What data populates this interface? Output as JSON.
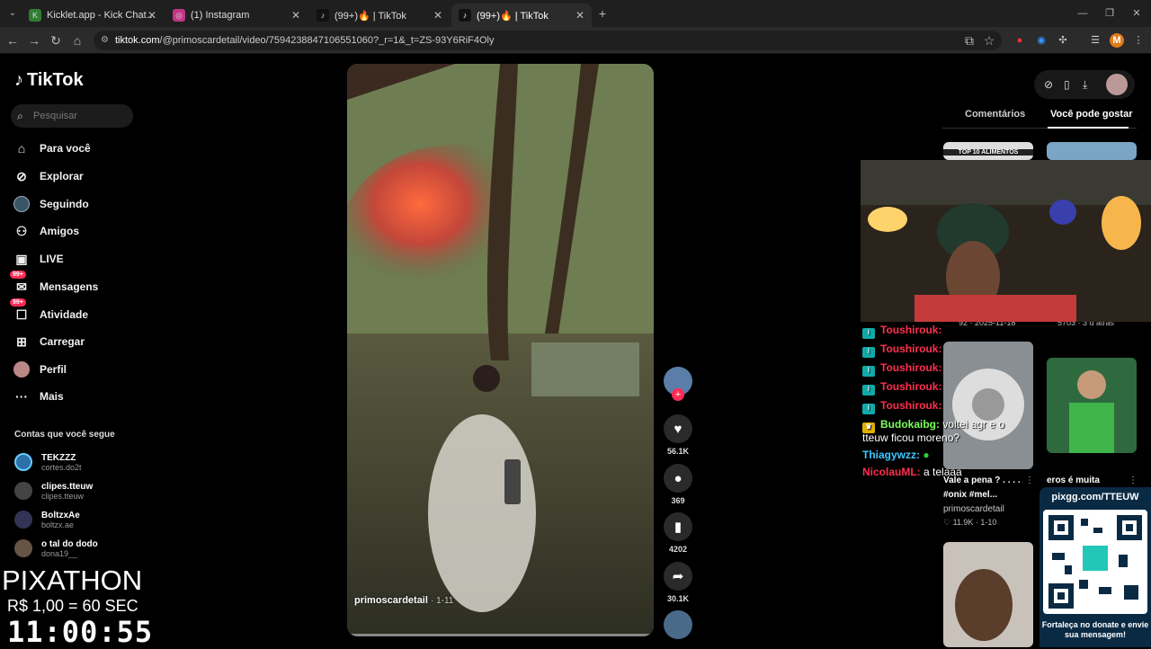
{
  "browser": {
    "tabs": [
      {
        "title": "Kicklet.app - Kick Chatbot and",
        "active": false
      },
      {
        "title": "(1) Instagram",
        "active": false
      },
      {
        "title": "(99+)🔥 | TikTok",
        "active": false
      },
      {
        "title": "(99+)🔥 | TikTok",
        "active": true
      }
    ],
    "url_host": "tiktok.com",
    "url_path": "/@primoscardetail/video/7594238847106551060?_r=1&_t=ZS-93Y6RiF4Oly",
    "profile_initial": "M"
  },
  "sidebar": {
    "logo": "TikTok",
    "search_placeholder": "Pesquisar",
    "items": [
      {
        "label": "Para você",
        "icon": "home-icon"
      },
      {
        "label": "Explorar",
        "icon": "compass-icon"
      },
      {
        "label": "Seguindo",
        "icon": "following-icon"
      },
      {
        "label": "Amigos",
        "icon": "friends-icon"
      },
      {
        "label": "LIVE",
        "icon": "live-icon"
      },
      {
        "label": "Mensagens",
        "icon": "messages-icon",
        "badge": "99+"
      },
      {
        "label": "Atividade",
        "icon": "activity-icon",
        "badge": "99+"
      },
      {
        "label": "Carregar",
        "icon": "upload-icon"
      },
      {
        "label": "Perfil",
        "icon": "profile-icon"
      },
      {
        "label": "Mais",
        "icon": "more-icon"
      }
    ],
    "following_heading": "Contas que você segue",
    "accounts": [
      {
        "name": "TEKZZZ",
        "handle": "cortes.do2t"
      },
      {
        "name": "clipes.tteuw",
        "handle": "clipes.tteuw"
      },
      {
        "name": "BoltzxAe",
        "handle": "boltzx.ae"
      },
      {
        "name": "o tal do dodo",
        "handle": "dona19__"
      }
    ]
  },
  "overlay": {
    "title": "PIXATHON",
    "rate": "R$ 1,00 = 60 SEC",
    "timer": "11:00:55"
  },
  "video": {
    "author": "primoscardetail",
    "date": "· 1-11",
    "likes": "56.1K",
    "comments": "369",
    "saves": "4202",
    "shares": "30.1K"
  },
  "right_panel": {
    "tab_comments": "Comentários",
    "tab_suggested": "Você pode gostar",
    "thumb_top_text": "TOP 10 ALIMENTOS",
    "top_stats_left": "92 · 2025-11-18",
    "top_stats_right": "5703 · 3 d atrás",
    "card1": {
      "caption_1": "Vale a pena ? . . . .",
      "caption_2": "#onix #mel...",
      "author": "primoscardetail",
      "stats": "♡ 11.9K · 1-10"
    },
    "card2": {
      "caption": "eros é muita"
    }
  },
  "chat": [
    {
      "user": "Toushirouk:",
      "message": "",
      "color": "red"
    },
    {
      "user": "Toushirouk:",
      "message": "",
      "color": "red"
    },
    {
      "user": "Toushirouk:",
      "message": "",
      "color": "red"
    },
    {
      "user": "Toushirouk:",
      "message": "",
      "color": "red"
    },
    {
      "user": "Toushirouk:",
      "message": "",
      "color": "red"
    },
    {
      "user": "Budokaibg:",
      "message": "voltei agr e o",
      "color": "green"
    },
    {
      "user": "",
      "message": "tteuw ficou moreno?",
      "color": "white"
    },
    {
      "user": "Thiagywzz:",
      "message": "",
      "color": "blue"
    },
    {
      "user": "NicolauML:",
      "message": "a telaaa",
      "color": "red"
    }
  ],
  "pixgg": {
    "url": "pixgg.com/TTEUW",
    "message": "Fortaleça no donate e envie sua mensagem!"
  },
  "colors": {
    "accent": "#fe2c55",
    "bg": "#000000"
  }
}
